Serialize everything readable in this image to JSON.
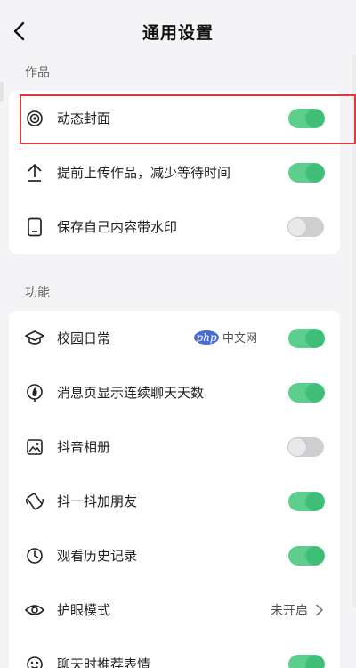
{
  "header": {
    "title": "通用设置"
  },
  "sections": [
    {
      "label": "作品",
      "items": [
        {
          "label": "动态封面",
          "icon": "dynamic-cover-icon",
          "state": "on"
        },
        {
          "label": "提前上传作品，减少等待时间",
          "icon": "upload-icon",
          "state": "on"
        },
        {
          "label": "保存自己内容带水印",
          "icon": "phone-save-icon",
          "state": "off"
        }
      ]
    },
    {
      "label": "功能",
      "items": [
        {
          "label": "校园日常",
          "icon": "graduation-cap-icon",
          "state": "on"
        },
        {
          "label": "消息页显示连续聊天天数",
          "icon": "flame-badge-icon",
          "state": "on"
        },
        {
          "label": "抖音相册",
          "icon": "album-icon",
          "state": "off"
        },
        {
          "label": "抖一抖加朋友",
          "icon": "shake-phone-icon",
          "state": "on"
        },
        {
          "label": "观看历史记录",
          "icon": "clock-icon",
          "state": "on"
        },
        {
          "label": "护眼模式",
          "icon": "eye-icon",
          "value": "未开启"
        },
        {
          "label": "聊天时推荐表情",
          "icon": "emoji-icon",
          "state": "on"
        }
      ]
    }
  ],
  "watermark": {
    "logo": "php",
    "text": "中文网"
  },
  "colors": {
    "toggle_on": "#5ccf8e",
    "toggle_off": "#cfcfd2",
    "highlight": "#e0383e"
  }
}
